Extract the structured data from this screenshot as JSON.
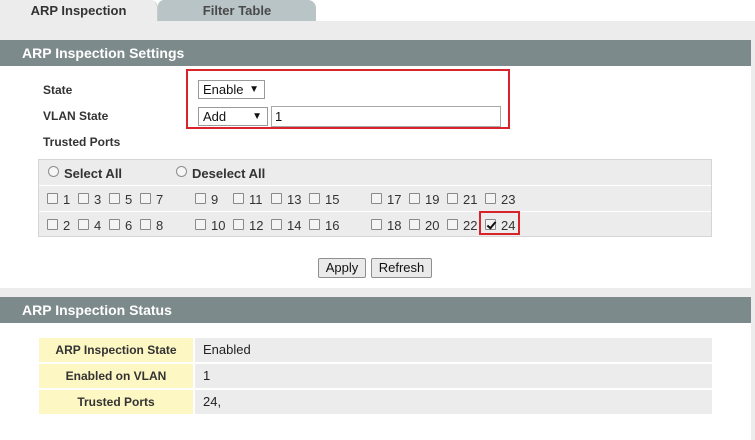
{
  "tabs": [
    {
      "label": "ARP Inspection",
      "active": true
    },
    {
      "label": "Filter Table",
      "active": false
    }
  ],
  "settings": {
    "header": "ARP Inspection Settings",
    "state_label": "State",
    "state_value": "Enable",
    "vlan_state_label": "VLAN State",
    "vlan_action_value": "Add",
    "vlan_input_value": "1",
    "trusted_ports_label": "Trusted Ports",
    "select_all_label": "Select All",
    "deselect_all_label": "Deselect All",
    "ports_row1": [
      "1",
      "3",
      "5",
      "7",
      "9",
      "11",
      "13",
      "15",
      "17",
      "19",
      "21",
      "23"
    ],
    "ports_row2": [
      "2",
      "4",
      "6",
      "8",
      "10",
      "12",
      "14",
      "16",
      "18",
      "20",
      "22",
      "24"
    ],
    "checked_ports": [
      "24"
    ],
    "apply_label": "Apply",
    "refresh_label": "Refresh",
    "dropdown_arrow": "▼"
  },
  "status": {
    "header": "ARP Inspection Status",
    "rows": [
      {
        "label": "ARP Inspection State",
        "value": "Enabled"
      },
      {
        "label": "Enabled on VLAN",
        "value": "1"
      },
      {
        "label": "Trusted Ports",
        "value": "24,"
      }
    ]
  },
  "colors": {
    "header_bg": "#7d8a8b",
    "highlight_border": "#d9232a",
    "status_label_bg": "#fdf7c3"
  }
}
